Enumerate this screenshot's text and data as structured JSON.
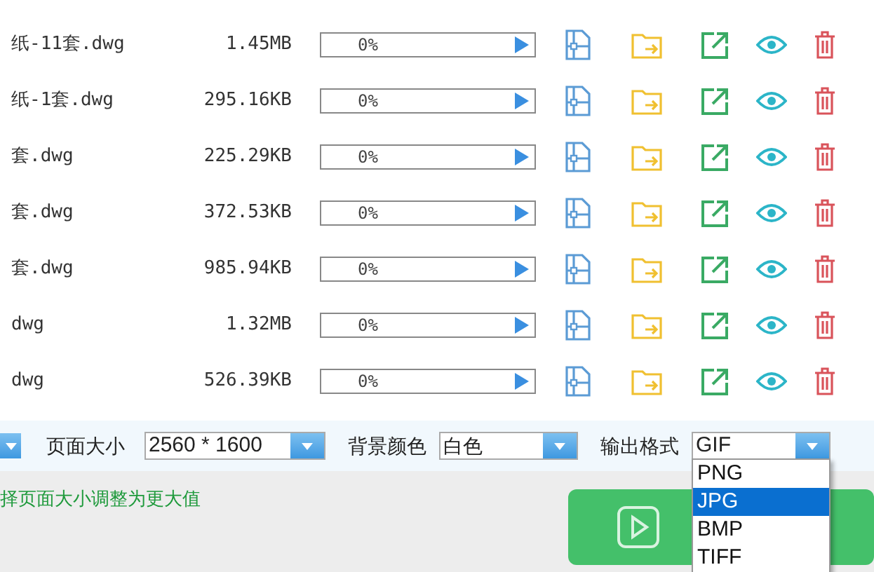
{
  "files": [
    {
      "name": "纸-11套.dwg",
      "size": "1.45MB",
      "progress": "0%",
      "level": 0
    },
    {
      "name": "纸-1套.dwg",
      "size": "295.16KB",
      "progress": "0%",
      "level": 0
    },
    {
      "name": "套.dwg",
      "size": "225.29KB",
      "progress": "0%",
      "level": 0
    },
    {
      "name": "套.dwg",
      "size": "372.53KB",
      "progress": "0%",
      "level": 0
    },
    {
      "name": "套.dwg",
      "size": "985.94KB",
      "progress": "0%",
      "level": 0
    },
    {
      "name": "dwg",
      "size": "1.32MB",
      "progress": "0%",
      "level": 0
    },
    {
      "name": "dwg",
      "size": "526.39KB",
      "progress": "0%",
      "level": 0
    }
  ],
  "settings": {
    "page_size_label": "页面大小",
    "page_size": "2560 * 1600",
    "background_label": "背景颜色",
    "background": "白色",
    "format_label": "输出格式",
    "format": "GIF",
    "format_options": [
      {
        "label": "PNG",
        "selected": false
      },
      {
        "label": "JPG",
        "selected": true
      },
      {
        "label": "BMP",
        "selected": false
      },
      {
        "label": "TIFF",
        "selected": false
      }
    ]
  },
  "hint": "择页面大小调整为更大值"
}
